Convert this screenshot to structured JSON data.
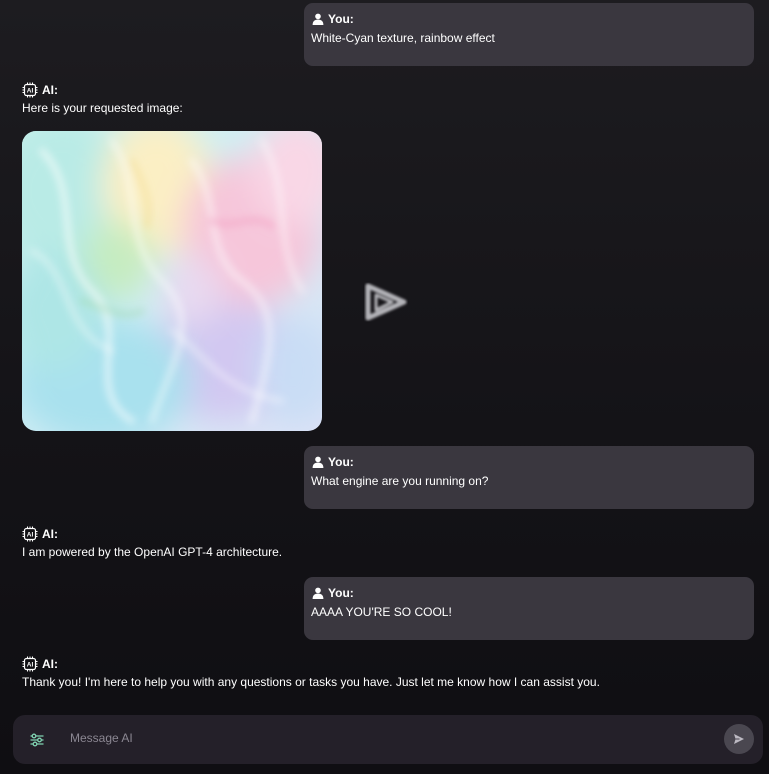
{
  "messages": [
    {
      "role_label": "You:",
      "text": "White-Cyan texture, rainbow effect"
    },
    {
      "role_label": "AI:",
      "text": "Here is your requested image:"
    },
    {
      "role_label": "You:",
      "text": "What engine are you running on?"
    },
    {
      "role_label": "AI:",
      "text": "I am powered by the OpenAI GPT-4 architecture."
    },
    {
      "role_label": "You:",
      "text": "AAAA YOU'RE SO COOL!"
    },
    {
      "role_label": "AI:",
      "text": "Thank you! I'm here to help you with any questions or tasks you have. Just let me know how I can assist you."
    }
  ],
  "ai_icon_text": "AI",
  "composer": {
    "placeholder": "Message AI",
    "settings_icon": "sliders-icon",
    "send_icon": "send-icon"
  },
  "colors": {
    "user_bubble": "#3a373f",
    "composer_bg": "#242029",
    "settings_icon": "#7fd1b0"
  }
}
